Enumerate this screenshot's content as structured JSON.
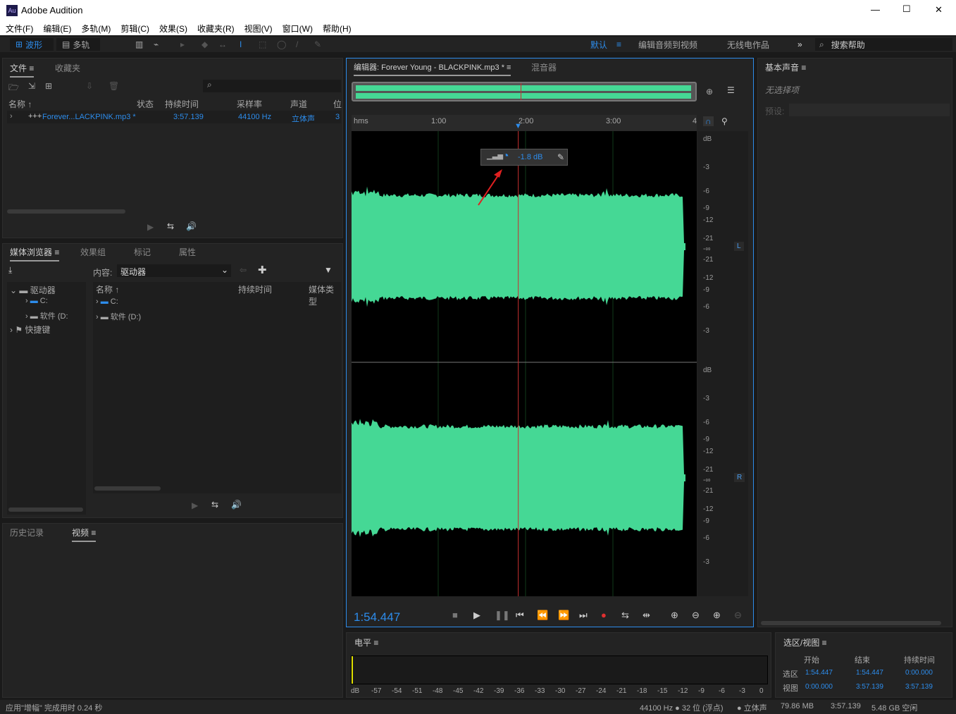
{
  "window": {
    "app_icon": "Au",
    "title": "Adobe Audition",
    "min": "—",
    "max": "☐",
    "close": "✕"
  },
  "menu": [
    "文件(F)",
    "编辑(E)",
    "多轨(M)",
    "剪辑(C)",
    "效果(S)",
    "收藏夹(R)",
    "视图(V)",
    "窗口(W)",
    "帮助(H)"
  ],
  "toolbar": {
    "waveform": "波形",
    "multitrack": "多轨",
    "workspaces": [
      "默认",
      "编辑音频到视频",
      "无线电作品"
    ],
    "more": "»",
    "search_placeholder": "搜索帮助"
  },
  "files_panel": {
    "tabs": [
      "文件",
      "收藏夹"
    ],
    "search_icon": "⌕",
    "columns": [
      "名称 ↑",
      "状态",
      "持续时间",
      "采样率",
      "声道",
      "位"
    ],
    "rows": [
      {
        "name": "Forever...LACKPINK.mp3 *",
        "duration": "3:57.139",
        "rate": "44100 Hz",
        "channels": "立体声",
        "bits": "3"
      }
    ]
  },
  "media_panel": {
    "tabs": [
      "媒体浏览器",
      "效果组",
      "标记",
      "属性"
    ],
    "content_label": "内容:",
    "content_value": "驱动器",
    "tree": [
      "驱动器",
      "C:",
      "软件 (D:",
      "快捷键"
    ],
    "columns": [
      "名称 ↑",
      "持续时间",
      "媒体类型"
    ],
    "items": [
      "C:",
      "软件 (D:)"
    ]
  },
  "history_panel": {
    "tabs": [
      "历史记录",
      "视频"
    ]
  },
  "editor": {
    "tab": "编辑器: Forever Young - BLACKPINK.mp3 *",
    "mixer_tab": "混音器",
    "ruler": [
      "hms",
      "1:00",
      "2:00",
      "3:00",
      "4"
    ],
    "hud_value": "-1.8 dB",
    "db_scale": [
      "dB",
      "-3",
      "-6",
      "-9",
      "-12",
      "-21",
      "-∞",
      "-21",
      "-12",
      "-9",
      "-6",
      "-3"
    ],
    "channels": [
      "L",
      "R"
    ],
    "time": "1:54.447",
    "playhead_fraction": 0.483,
    "colors": {
      "waveform": "#45d895",
      "playhead": "#c83030",
      "accent": "#2d8ceb"
    }
  },
  "essential_sound": {
    "title": "基本声音",
    "no_selection": "无选择项",
    "preset_label": "预设:"
  },
  "levels": {
    "title": "电平",
    "scale": [
      "dB",
      "-57",
      "-54",
      "-51",
      "-48",
      "-45",
      "-42",
      "-39",
      "-36",
      "-33",
      "-30",
      "-27",
      "-24",
      "-21",
      "-18",
      "-15",
      "-12",
      "-9",
      "-6",
      "-3",
      "0"
    ]
  },
  "selection_view": {
    "title": "选区/视图",
    "headers": [
      "开始",
      "结束",
      "持续时间"
    ],
    "rows": [
      {
        "label": "选区",
        "start": "1:54.447",
        "end": "1:54.447",
        "dur": "0:00.000"
      },
      {
        "label": "视图",
        "start": "0:00.000",
        "end": "3:57.139",
        "dur": "3:57.139"
      }
    ]
  },
  "status": {
    "message": "应用\"增幅\" 完成用时 0.24 秒",
    "format": "44100 Hz ● 32 位 (浮点)",
    "channels": "● 立体声",
    "size": "79.86 MB",
    "duration": "3:57.139",
    "free": "5.48 GB 空闲"
  }
}
